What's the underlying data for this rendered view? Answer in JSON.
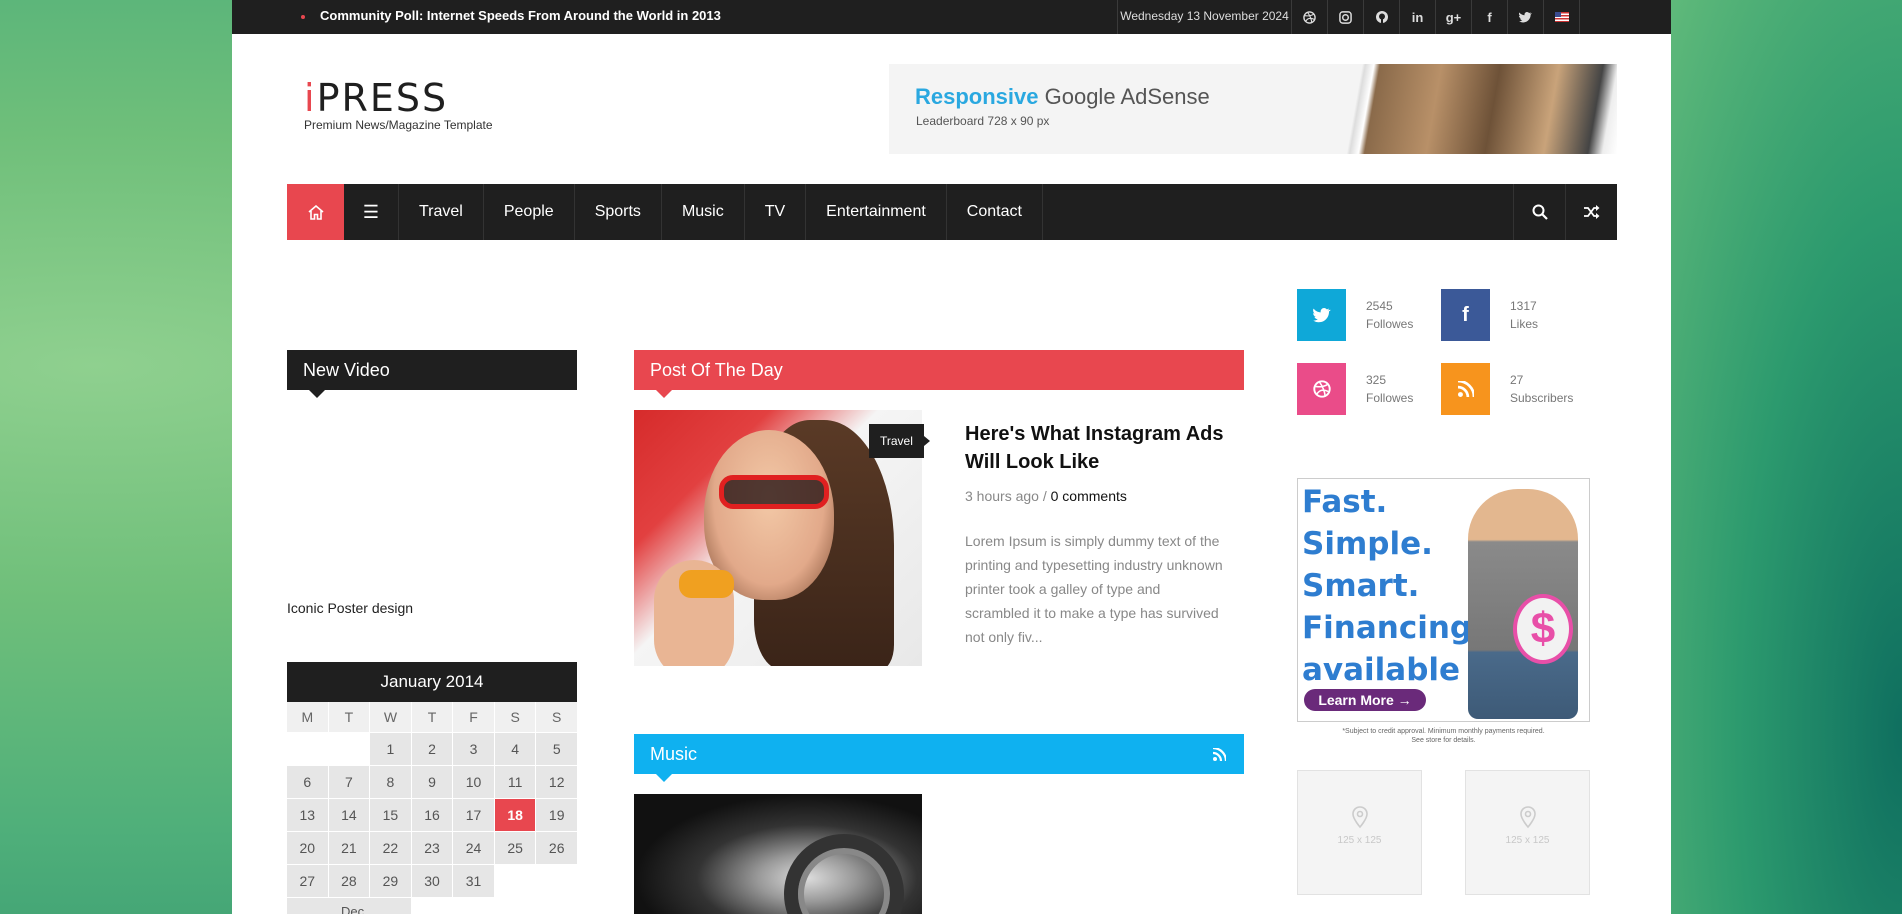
{
  "topbar": {
    "headline": "Community Poll: Internet Speeds From Around the World in 2013",
    "date": "Wednesday 13 November 2024",
    "social_icons": [
      "dribbble-icon",
      "instagram-icon",
      "github-icon",
      "linkedin-icon",
      "google-plus-icon",
      "facebook-icon",
      "twitter-icon",
      "us-flag-icon"
    ]
  },
  "logo": {
    "first_letter": "i",
    "name": "Press",
    "tagline": "Premium News/Magazine Template"
  },
  "banner": {
    "highlight": "Responsive",
    "title_rest": " Google AdSense",
    "size": "Leaderboard 728 x 90 px"
  },
  "nav": {
    "items": [
      "Travel",
      "People",
      "Sports",
      "Music",
      "TV",
      "Entertainment",
      "Contact"
    ]
  },
  "new_video": {
    "title": "New Video",
    "caption": "Iconic Poster design"
  },
  "calendar": {
    "month": "January 2014",
    "days_of_week": [
      "M",
      "T",
      "W",
      "T",
      "F",
      "S",
      "S"
    ],
    "leading_blanks": 2,
    "days": 31,
    "today": 18,
    "prev_link": "Dec"
  },
  "post_of_day": {
    "title": "Post Of The Day",
    "category": "Travel",
    "headline": "Here's What Instagram Ads Will Look Like",
    "time": "3 hours ago / ",
    "comments": "0 comments",
    "excerpt": "Lorem Ipsum is simply dummy text of the printing and typesetting industry unknown printer took a galley of type and scrambled it to make a type has survived not only fiv..."
  },
  "music": {
    "title": "Music"
  },
  "counters": [
    {
      "count": "2545",
      "label": "Followes",
      "icon": "twitter-icon",
      "color": "#0fa8d8"
    },
    {
      "count": "1317",
      "label": "Likes",
      "icon": "facebook-icon",
      "color": "#3b5998"
    },
    {
      "count": "325",
      "label": "Followes",
      "icon": "dribbble-icon",
      "color": "#ea4c89"
    },
    {
      "count": "27",
      "label": "Subscribers",
      "icon": "rss-icon",
      "color": "#f7941d"
    }
  ],
  "side_ad": {
    "lines": [
      "Fast.",
      "Simple.",
      "Smart.",
      "Financing",
      "available"
    ],
    "dollar": "$",
    "cta": "Learn More →",
    "fine_print_1": "*Subject to credit approval. Minimum monthly payments required.",
    "fine_print_2": "See store for details."
  },
  "small_ads": [
    "125 x 125",
    "125 x 125"
  ],
  "colors": {
    "accent_red": "#e8474f",
    "accent_blue": "#0fb1f0",
    "dark": "#1f1f1f"
  }
}
